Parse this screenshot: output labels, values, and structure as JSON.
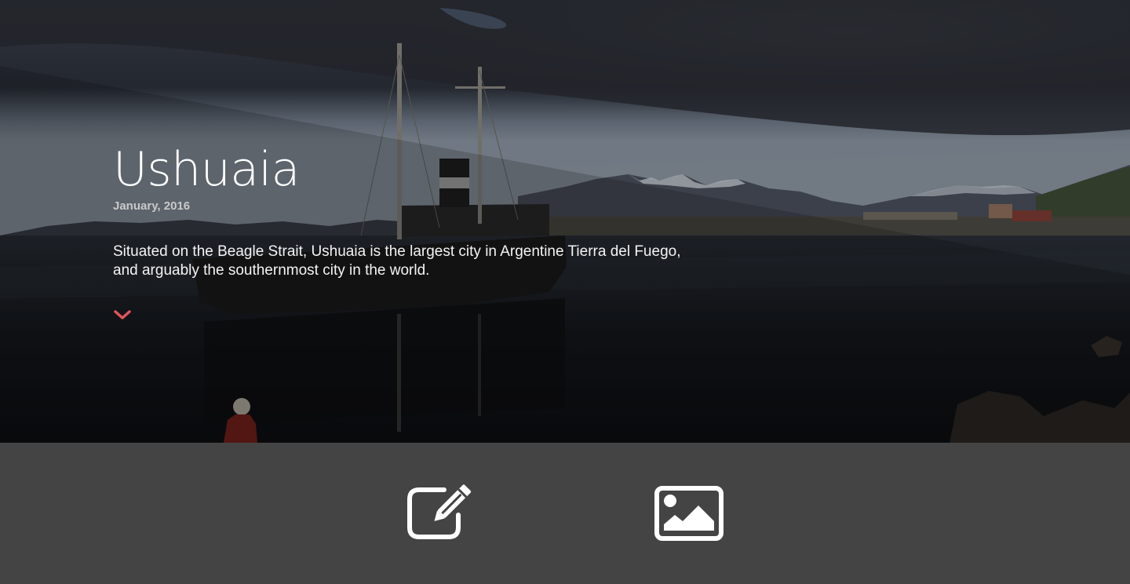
{
  "hero": {
    "title": "Ushuaia",
    "date": "January, 2016",
    "description": "Situated on the Beagle Strait, Ushuaia is the largest city in Argentine Tierra del Fuego, and arguably the southernmost city in the world.",
    "scroll_icon": "chevron-down-icon",
    "accent_color": "#e0555a"
  },
  "actions": {
    "edit_icon": "edit-icon",
    "image_icon": "image-icon"
  },
  "colors": {
    "bottom_bar": "#454444",
    "text": "#ffffff",
    "date": "#c9c9c9"
  }
}
